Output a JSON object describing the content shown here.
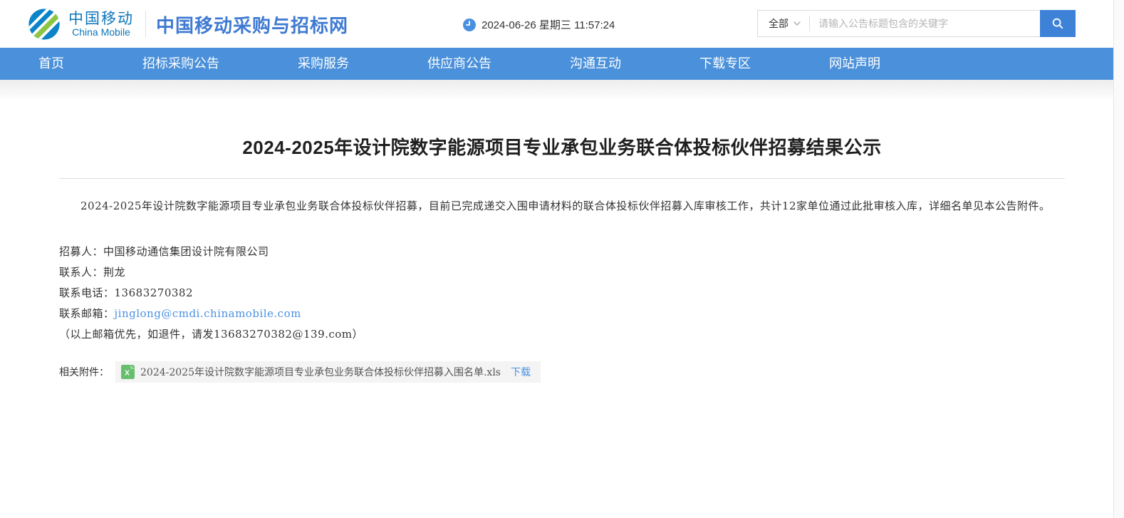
{
  "header": {
    "logo": {
      "cn": "中国移动",
      "en": "China Mobile"
    },
    "site_title": "中国移动采购与招标网",
    "datetime": "2024-06-26 星期三 11:57:24",
    "search": {
      "category": "全部",
      "placeholder": "请输入公告标题包含的关键字"
    }
  },
  "nav": {
    "items": [
      "首页",
      "招标采购公告",
      "采购服务",
      "供应商公告",
      "沟通互动",
      "下载专区",
      "网站声明"
    ]
  },
  "article": {
    "title": "2024-2025年设计院数字能源项目专业承包业务联合体投标伙伴招募结果公示",
    "paragraph": "2024-2025年设计院数字能源项目专业承包业务联合体投标伙伴招募，目前已完成递交入围申请材料的联合体投标伙伴招募入库审核工作，共计12家单位通过此批审核入库，详细名单见本公告附件。",
    "fields": [
      {
        "label": "招募人：",
        "value": "中国移动通信集团设计院有限公司"
      },
      {
        "label": "联系人：",
        "value": "荆龙"
      },
      {
        "label": "联系电话：",
        "value": "13683270382"
      },
      {
        "label": "联系邮箱：",
        "value": "jinglong@cmdi.chinamobile.com"
      },
      {
        "label": "",
        "value": "（以上邮箱优先，如退件，请发13683270382@139.com）"
      }
    ],
    "attachment": {
      "label": "相关附件：",
      "filename": "2024-2025年设计院数字能源项目专业承包业务联合体投标伙伴招募入围名单.xls",
      "download_label": "下载"
    }
  },
  "icons": {
    "clock": "clock-icon",
    "search": "search-icon",
    "chevron_down": "chevron-down-icon",
    "excel": "excel-file-icon",
    "logo": "china-mobile-logo"
  },
  "colors": {
    "nav_blue": "#4a90da",
    "site_title_blue": "#3f7ad2",
    "logo_blue": "#0b76ba",
    "logo_green": "#8cc63f",
    "link_blue": "#4a90e2",
    "search_button_blue": "#3e82d8",
    "excel_green": "#67bf6d"
  }
}
